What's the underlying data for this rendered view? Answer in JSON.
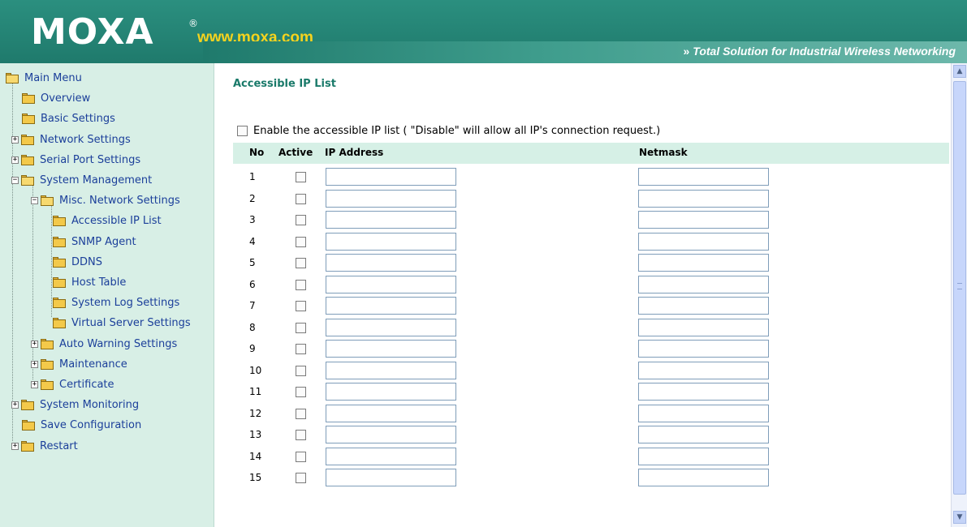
{
  "header": {
    "logo": "MOXA",
    "registered_mark": "®",
    "site_url": "www.moxa.com",
    "tagline_chevron": "»",
    "tagline": "Total Solution for Industrial Wireless Networking"
  },
  "sidebar": {
    "items": [
      {
        "label": "Main Menu",
        "icon": "open-folder-icon"
      },
      {
        "label": "Overview",
        "icon": "folder-icon"
      },
      {
        "label": "Basic Settings",
        "icon": "folder-icon"
      },
      {
        "label": "Network Settings",
        "icon": "folder-icon",
        "expandable": true
      },
      {
        "label": "Serial Port Settings",
        "icon": "folder-icon",
        "expandable": true
      },
      {
        "label": "System Management",
        "icon": "open-folder-icon",
        "expanded": true
      },
      {
        "label": "Misc. Network Settings",
        "icon": "open-folder-icon",
        "expanded": true
      },
      {
        "label": "Accessible IP List",
        "icon": "folder-icon"
      },
      {
        "label": "SNMP Agent",
        "icon": "folder-icon"
      },
      {
        "label": "DDNS",
        "icon": "folder-icon"
      },
      {
        "label": "Host Table",
        "icon": "folder-icon"
      },
      {
        "label": "System Log Settings",
        "icon": "folder-icon"
      },
      {
        "label": "Virtual Server Settings",
        "icon": "folder-icon"
      },
      {
        "label": "Auto Warning Settings",
        "icon": "folder-icon",
        "expandable": true
      },
      {
        "label": "Maintenance",
        "icon": "folder-icon",
        "expandable": true
      },
      {
        "label": "Certificate",
        "icon": "folder-icon",
        "expandable": true
      },
      {
        "label": "System Monitoring",
        "icon": "folder-icon",
        "expandable": true
      },
      {
        "label": "Save Configuration",
        "icon": "folder-icon"
      },
      {
        "label": "Restart",
        "icon": "folder-icon",
        "expandable": true
      }
    ]
  },
  "main": {
    "title": "Accessible IP List",
    "enable_label": "Enable the accessible IP list ( \"Disable\" will allow all IP's connection request.)",
    "columns": {
      "no": "No",
      "active": "Active",
      "ip": "IP Address",
      "netmask": "Netmask"
    },
    "rows": [
      {
        "no": "1",
        "ip": "",
        "netmask": ""
      },
      {
        "no": "2",
        "ip": "",
        "netmask": ""
      },
      {
        "no": "3",
        "ip": "",
        "netmask": ""
      },
      {
        "no": "4",
        "ip": "",
        "netmask": ""
      },
      {
        "no": "5",
        "ip": "",
        "netmask": ""
      },
      {
        "no": "6",
        "ip": "",
        "netmask": ""
      },
      {
        "no": "7",
        "ip": "",
        "netmask": ""
      },
      {
        "no": "8",
        "ip": "",
        "netmask": ""
      },
      {
        "no": "9",
        "ip": "",
        "netmask": ""
      },
      {
        "no": "10",
        "ip": "",
        "netmask": ""
      },
      {
        "no": "11",
        "ip": "",
        "netmask": ""
      },
      {
        "no": "12",
        "ip": "",
        "netmask": ""
      },
      {
        "no": "13",
        "ip": "",
        "netmask": ""
      },
      {
        "no": "14",
        "ip": "",
        "netmask": ""
      },
      {
        "no": "15",
        "ip": "",
        "netmask": ""
      }
    ]
  },
  "scrollbar": {
    "up_arrow": "▲",
    "down_arrow": "▼"
  },
  "colors": {
    "header": "#1f7a6c",
    "sidebar": "#d8efe6",
    "link": "#1b3f9a",
    "title": "#1a7a6a",
    "url": "#f6d31e"
  }
}
